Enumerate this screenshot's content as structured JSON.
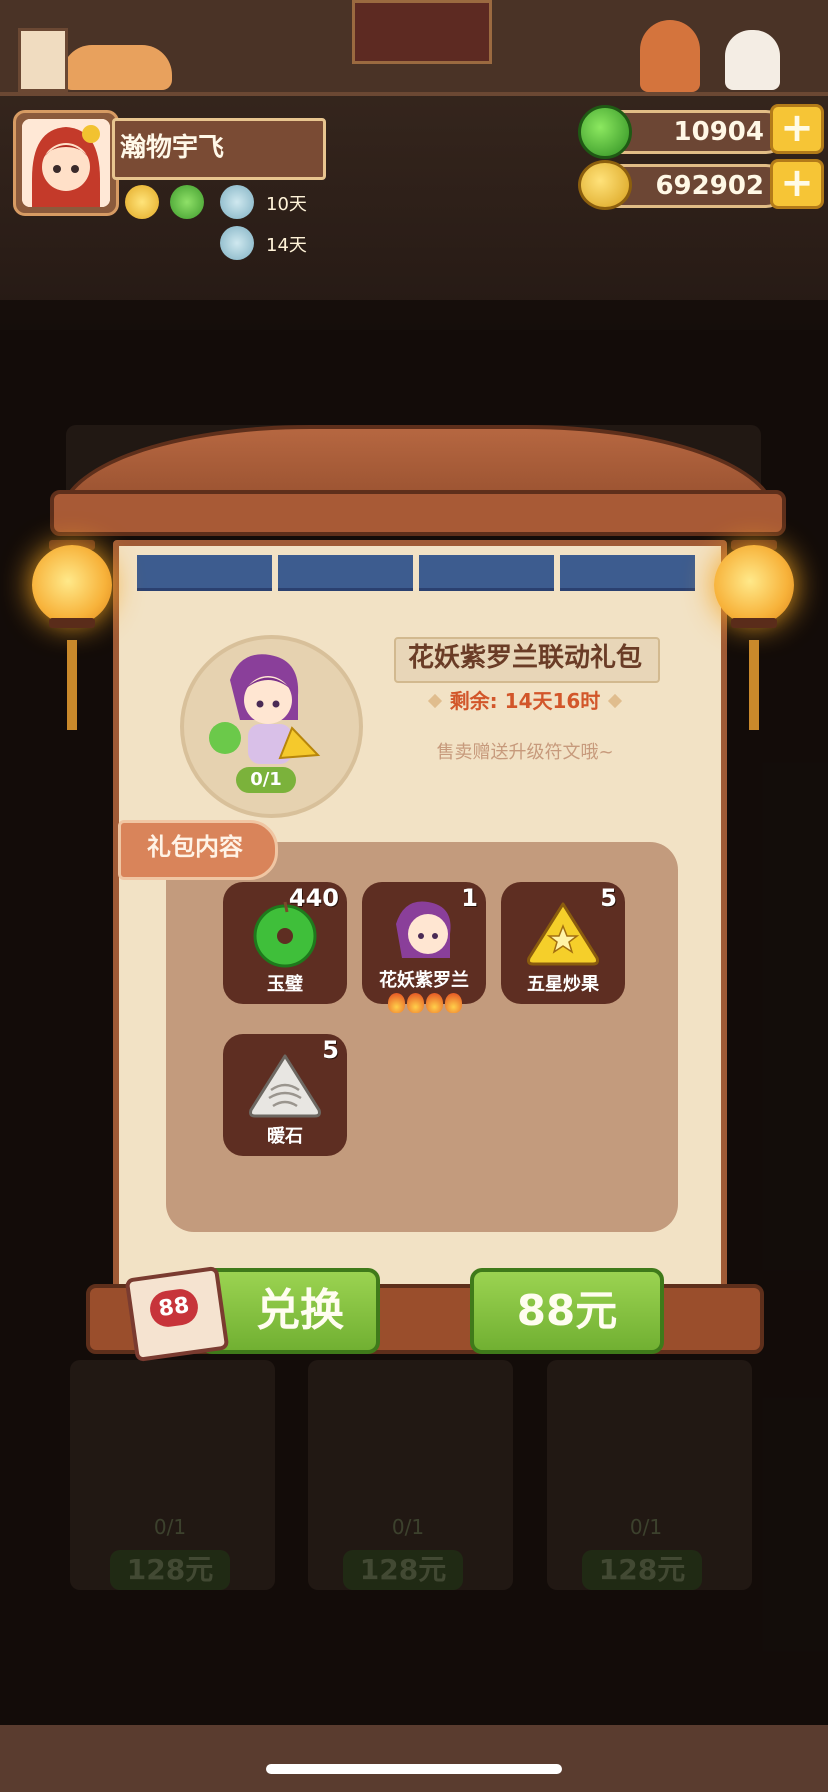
{
  "player": {
    "name": "瀚物宇飞",
    "buffs": [
      {
        "icon": "gold-coin-boost-icon",
        "label": ""
      },
      {
        "icon": "jade-boost-icon",
        "label": ""
      },
      {
        "icon": "food-plate-boost-icon",
        "label": "10天"
      },
      {
        "icon": "food-plate-boost-icon",
        "label": "14天"
      }
    ]
  },
  "currency": {
    "jade": {
      "value": "10904",
      "icon": "jade-icon"
    },
    "gold": {
      "value": "692902",
      "icon": "gold-coin-icon"
    }
  },
  "popup": {
    "title": "花妖紫罗兰联动礼包",
    "remaining": "剩余: 14天16时",
    "note": "售卖赠送升级符文哦~",
    "portrait_count": "0/1",
    "contents_label": "礼包内容",
    "items": [
      {
        "name": "玉璧",
        "qty": "440",
        "icon": "jade-disc-icon"
      },
      {
        "name": "花妖紫罗兰",
        "qty": "1",
        "icon": "violet-character-icon",
        "stars": 4
      },
      {
        "name": "五星炒果",
        "qty": "5",
        "icon": "star-fruit-icon"
      },
      {
        "name": "暖石",
        "qty": "5",
        "icon": "warm-stone-icon"
      }
    ],
    "exchange_label": "兑换",
    "ticket_value": "88",
    "price_label": "88元"
  },
  "colors": {
    "accent_green": "#7bb23b",
    "title_brown": "#6a3c26",
    "remaining_red": "#d2562a",
    "panel_cream": "#f2e2c5",
    "frame_brown": "#a05b36"
  }
}
